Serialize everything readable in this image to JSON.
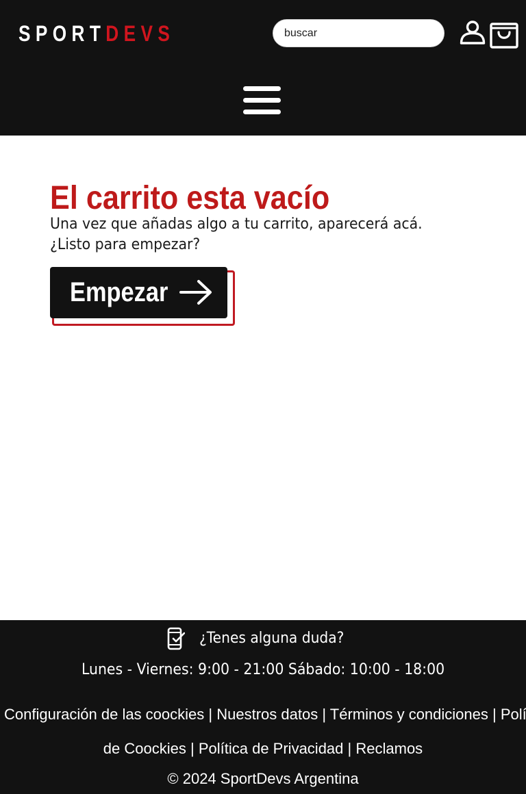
{
  "header": {
    "logo": {
      "part1": "SPORT",
      "part2": "DEVS"
    },
    "search": {
      "placeholder": "buscar",
      "value": ""
    },
    "icons": {
      "user": "user-icon",
      "cart": "cart-bag-icon",
      "menu": "hamburger-menu-icon"
    }
  },
  "main": {
    "title": "El carrito esta vacío",
    "description_line1": "Una vez que añadas algo a tu carrito, aparecerá acá.",
    "description_line2": "¿Listo para empezar?",
    "cta_label": "Empezar",
    "cta_icon": "arrow-right-icon"
  },
  "footer": {
    "doubt_text": "¿Tenes alguna duda?",
    "doubt_icon": "mobile-check-icon",
    "hours": "Lunes - Viernes: 9:00 - 21:00 Sábado: 10:00 - 18:00",
    "links": [
      "Configuración de las coockies",
      "Nuestros datos",
      "Términos y condiciones",
      "Política de Coockies",
      "Política de Privacidad",
      "Reclamos"
    ],
    "link4_part1": "Política",
    "link4_part2": "de Coockies",
    "separator": "|",
    "copyright": "©  2024  SportDevs Argentina"
  },
  "colors": {
    "header_bg": "#121212",
    "brand_red": "#d0151e",
    "title_red": "#be1a1a",
    "button_bg": "#121212",
    "button_outline": "#c01a22",
    "footer_bg": "#121212"
  }
}
